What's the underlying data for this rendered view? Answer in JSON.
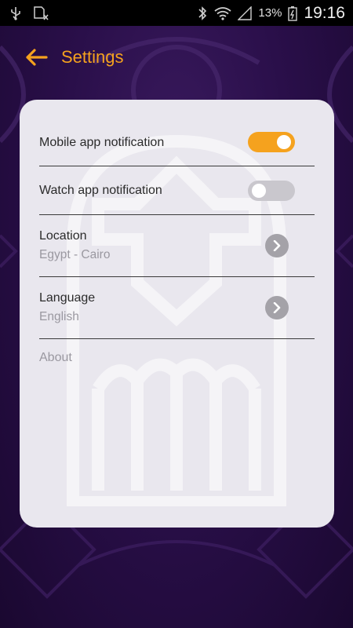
{
  "status_bar": {
    "icons": [
      "usb-icon",
      "sim-card-icon",
      "bluetooth-icon",
      "wifi-icon",
      "signal-icon",
      "battery-icon"
    ],
    "battery_percent": "13%",
    "time": "19:16"
  },
  "app_bar": {
    "title": "Settings",
    "back_icon": "arrow-left-icon"
  },
  "settings": {
    "mobile_notification": {
      "label": "Mobile app notification",
      "enabled": true
    },
    "watch_notification": {
      "label": "Watch app notification",
      "enabled": false
    },
    "location": {
      "label": "Location",
      "value": "Egypt - Cairo"
    },
    "language": {
      "label": "Language",
      "value": "English"
    },
    "about": {
      "label": "About"
    }
  },
  "colors": {
    "accent": "#f5a21e",
    "background": "#2a0f4a",
    "card": "#e9e7ee",
    "toggle_off": "#c9c7cd",
    "chevron_bg": "#a4a2a8"
  }
}
